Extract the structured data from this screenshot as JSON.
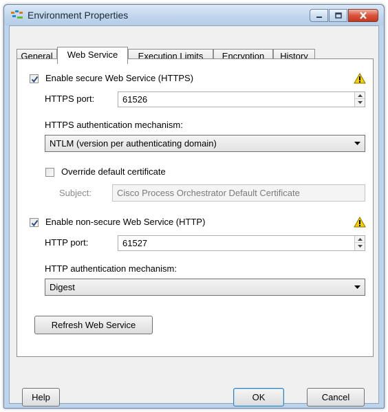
{
  "window": {
    "title": "Environment Properties"
  },
  "tabs": [
    {
      "label": "General"
    },
    {
      "label": "Web Service"
    },
    {
      "label": "Execution Limits"
    },
    {
      "label": "Encryption"
    },
    {
      "label": "History"
    }
  ],
  "active_tab": "Web Service",
  "https": {
    "enable_label": "Enable secure Web Service (HTTPS)",
    "enabled": true,
    "port_label": "HTTPS port:",
    "port_value": "61526",
    "auth_label": "HTTPS authentication mechanism:",
    "auth_value": "NTLM (version per authenticating domain)",
    "override_label": "Override default certificate",
    "override_checked": false,
    "subject_label": "Subject:",
    "subject_value": "Cisco Process Orchestrator Default Certificate"
  },
  "http": {
    "enable_label": "Enable non-secure Web Service (HTTP)",
    "enabled": true,
    "port_label": "HTTP port:",
    "port_value": "61527",
    "auth_label": "HTTP authentication mechanism:",
    "auth_value": "Digest"
  },
  "buttons": {
    "refresh": "Refresh Web Service",
    "help": "Help",
    "ok": "OK",
    "cancel": "Cancel"
  },
  "colors": {
    "warning": "#f5d000",
    "checkmark": "#2a4b8d",
    "close_button": "#c8432a"
  },
  "icons": {
    "app": "environment-icon",
    "warning": "warning-triangle-icon"
  }
}
